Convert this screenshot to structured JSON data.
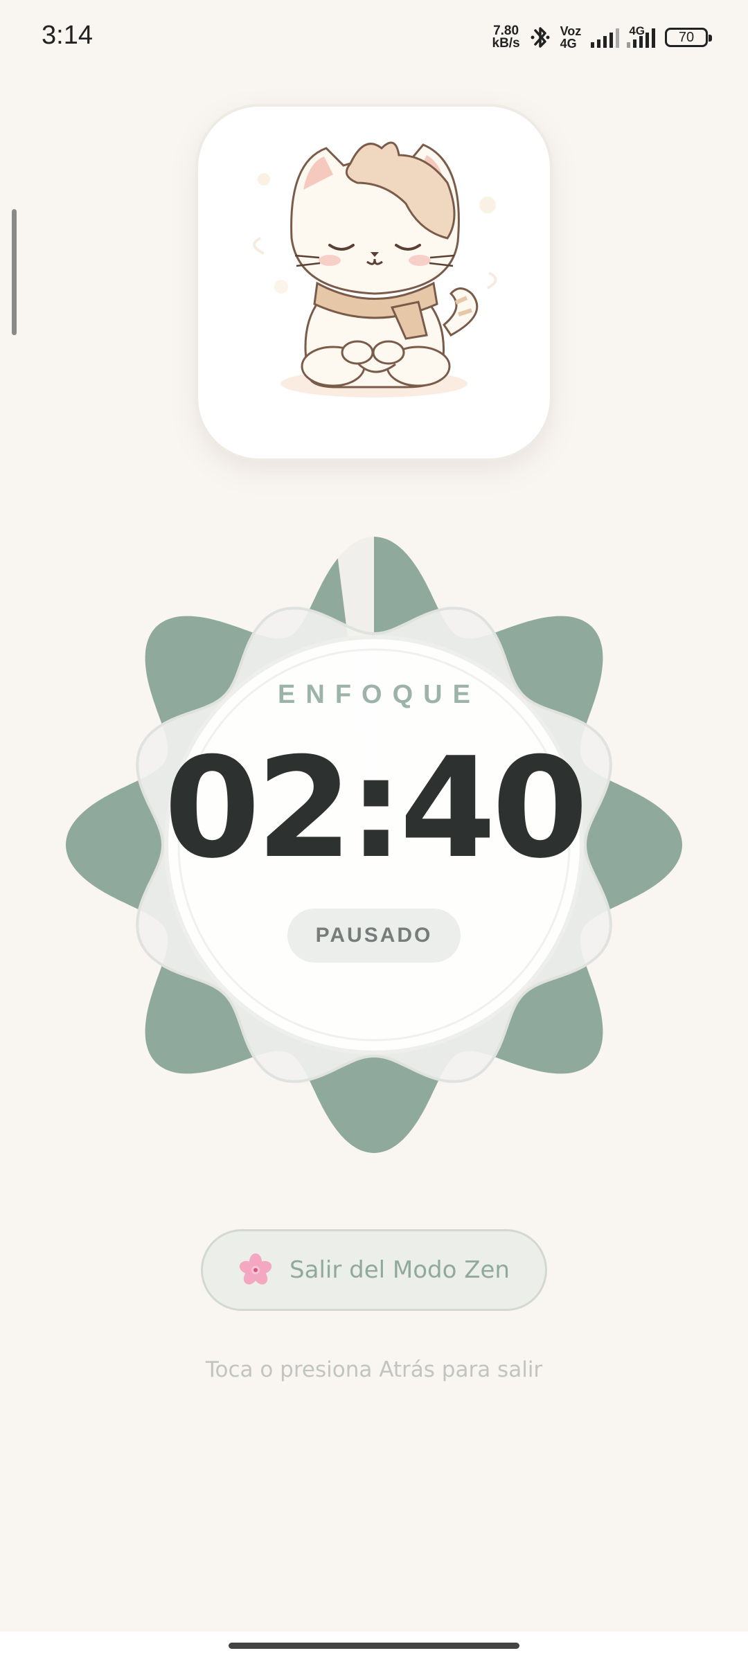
{
  "status_bar": {
    "time": "3:14",
    "net_speed_value": "7.80",
    "net_speed_unit": "kB/s",
    "voz_top": "Voz",
    "voz_bottom": "4G",
    "sim2_label": "4G",
    "battery_level": "70",
    "icons": [
      "bluetooth-icon",
      "signal-icon",
      "signal-icon",
      "battery-icon"
    ]
  },
  "mascot": {
    "icon": "sleeping-cat-mascot"
  },
  "timer": {
    "mode_label": "ENFOQUE",
    "time_remaining": "02:40",
    "status": "PAUSADO",
    "progress_fraction": 0.98,
    "colors": {
      "primary": "#8fa99c",
      "text": "#2d3130"
    }
  },
  "exit_button": {
    "label": "Salir del Modo Zen",
    "icon": "cherry-blossom-icon"
  },
  "hint": "Toca o presiona Atrás para salir"
}
